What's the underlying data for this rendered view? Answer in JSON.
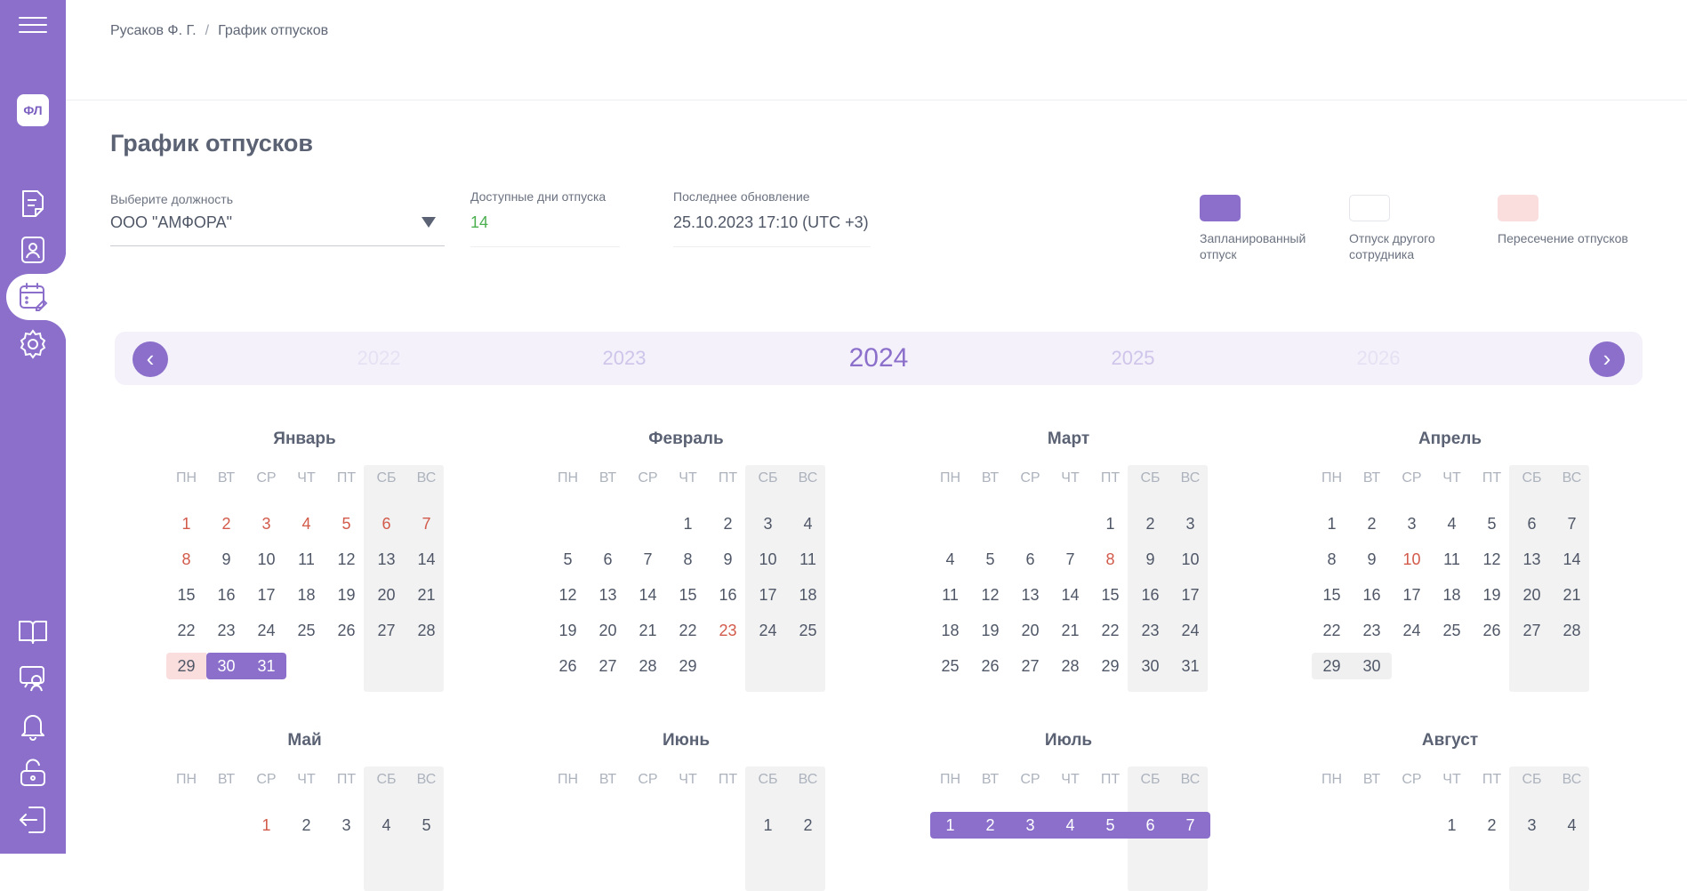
{
  "header": {
    "breadcrumb": [
      "Русаков Ф. Г.",
      "График отпусков"
    ],
    "separator": "/"
  },
  "page": {
    "title": "График отпусков"
  },
  "sidebar": {
    "logo": "ФЛ",
    "accent": "#8b6fcb",
    "items": [
      {
        "icon": "menu-icon"
      },
      {
        "icon": "document-icon"
      },
      {
        "icon": "employee-card-icon"
      },
      {
        "icon": "vacation-calendar-icon",
        "active": true
      },
      {
        "icon": "settings-icon"
      },
      {
        "icon": "book-icon"
      },
      {
        "icon": "training-icon"
      },
      {
        "icon": "bell-icon"
      },
      {
        "icon": "unlock-icon"
      },
      {
        "icon": "logout-icon"
      }
    ]
  },
  "filters": {
    "position": {
      "label": "Выберите должность",
      "value": "ООО \"АМФОРА\""
    },
    "available_days": {
      "label": "Доступные дни отпуска",
      "value": "14",
      "color": "#4caf50"
    },
    "last_update": {
      "label": "Последнее обновление",
      "value": "25.10.2023 17:10 (UTC +3)"
    }
  },
  "legend": [
    {
      "label": "Запланированный отпуск",
      "color": "#8b6fcb"
    },
    {
      "label": "Отпуск другого сотрудника",
      "color": "#ffffff"
    },
    {
      "label": "Пересечение отпусков",
      "color": "#fadddd"
    }
  ],
  "years": {
    "items": [
      "2022",
      "2023",
      "2024",
      "2025",
      "2026"
    ],
    "selected": "2024"
  },
  "weekdays": [
    "ПН",
    "ВТ",
    "СР",
    "ЧТ",
    "ПТ",
    "СБ",
    "ВС"
  ],
  "months": [
    {
      "name": "Январь",
      "offset": 0,
      "days": 31,
      "holidays": [
        1,
        2,
        3,
        4,
        5,
        6,
        7,
        8
      ],
      "overlap": [
        29
      ],
      "planned": [
        30,
        31
      ],
      "other": []
    },
    {
      "name": "Февраль",
      "offset": 3,
      "days": 29,
      "holidays": [
        23
      ],
      "overlap": [],
      "planned": [],
      "other": []
    },
    {
      "name": "Март",
      "offset": 4,
      "days": 31,
      "holidays": [
        8
      ],
      "overlap": [],
      "planned": [],
      "other": []
    },
    {
      "name": "Апрель",
      "offset": 0,
      "days": 30,
      "holidays": [
        10
      ],
      "overlap": [],
      "planned": [],
      "other": [
        29,
        30
      ]
    },
    {
      "name": "Май",
      "offset": 2,
      "days": 5,
      "holidays": [
        1
      ],
      "overlap": [],
      "planned": [],
      "other": []
    },
    {
      "name": "Июнь",
      "offset": 5,
      "days": 2,
      "holidays": [],
      "overlap": [],
      "planned": [],
      "other": []
    },
    {
      "name": "Июль",
      "offset": 0,
      "days": 7,
      "holidays": [],
      "overlap": [],
      "planned": [
        1,
        2,
        3,
        4,
        5,
        6,
        7
      ],
      "other": []
    },
    {
      "name": "Август",
      "offset": 3,
      "days": 4,
      "holidays": [],
      "overlap": [],
      "planned": [],
      "other": []
    }
  ]
}
